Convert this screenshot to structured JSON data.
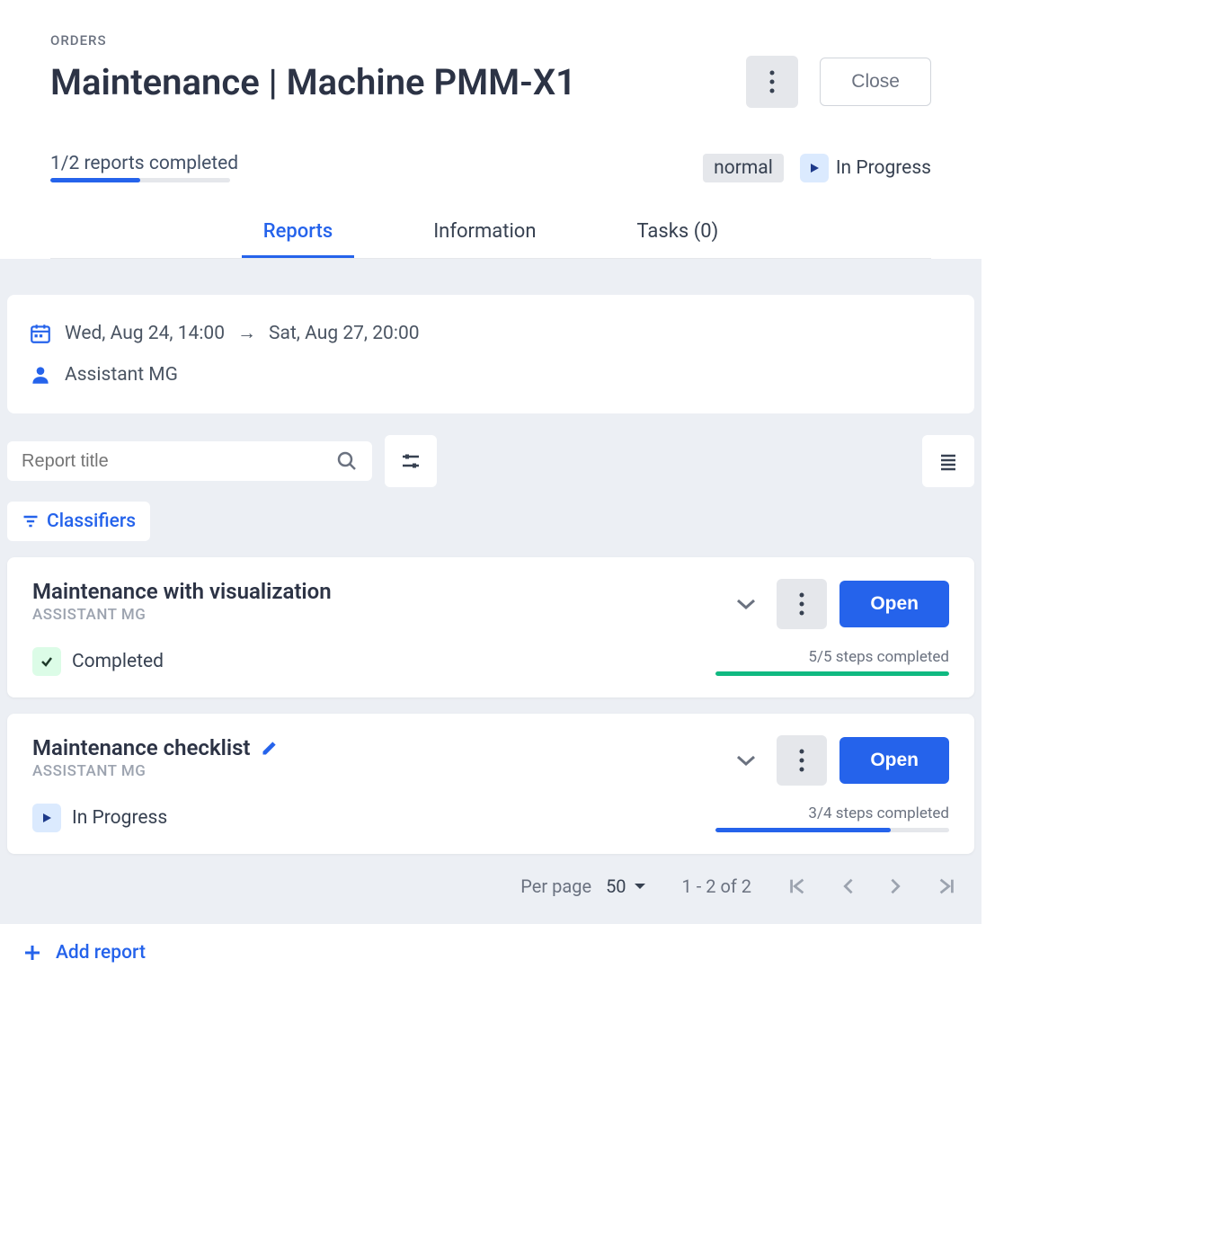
{
  "header": {
    "breadcrumb": "ORDERS",
    "title": "Maintenance | Machine PMM-X1",
    "close_label": "Close"
  },
  "progress": {
    "label": "1/2 reports completed",
    "percent": 50
  },
  "status": {
    "priority": "normal",
    "state": "In Progress"
  },
  "tabs": {
    "reports": "Reports",
    "information": "Information",
    "tasks": "Tasks (0)"
  },
  "schedule": {
    "start": "Wed, Aug 24, 14:00",
    "arrow": "→",
    "end": "Sat, Aug 27, 20:00"
  },
  "assignee": "Assistant MG",
  "search": {
    "placeholder": "Report title"
  },
  "classifiers_label": "Classifiers",
  "reports": [
    {
      "title": "Maintenance with visualization",
      "author": "ASSISTANT MG",
      "status": "Completed",
      "status_type": "completed",
      "steps_label": "5/5 steps completed",
      "steps_percent": 100,
      "editable": false
    },
    {
      "title": "Maintenance checklist",
      "author": "ASSISTANT MG",
      "status": "In Progress",
      "status_type": "in_progress",
      "steps_label": "3/4 steps completed",
      "steps_percent": 75,
      "editable": true
    }
  ],
  "open_label": "Open",
  "pagination": {
    "per_page_label": "Per page",
    "per_page_value": "50",
    "range": "1 - 2 of 2"
  },
  "add_report_label": "Add report"
}
